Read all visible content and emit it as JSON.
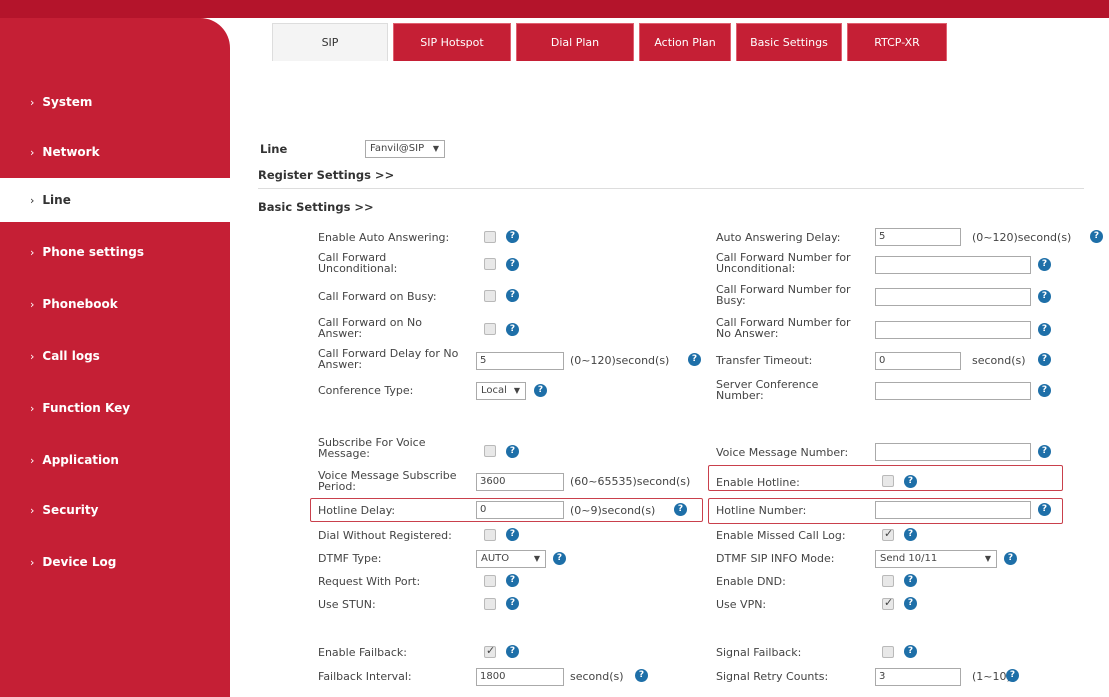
{
  "tabs": [
    "SIP",
    "SIP Hotspot",
    "Dial Plan",
    "Action Plan",
    "Basic Settings",
    "RTCP-XR"
  ],
  "sidebar": {
    "items": [
      {
        "label": "System"
      },
      {
        "label": "Network"
      },
      {
        "label": "Line"
      },
      {
        "label": "Phone settings"
      },
      {
        "label": "Phonebook"
      },
      {
        "label": "Call logs"
      },
      {
        "label": "Function Key"
      },
      {
        "label": "Application"
      },
      {
        "label": "Security"
      },
      {
        "label": "Device Log"
      }
    ],
    "active": "Line"
  },
  "line": {
    "label": "Line",
    "value": "Fanvil@SIP"
  },
  "sections": {
    "register": "Register Settings >>",
    "basic": "Basic Settings >>"
  },
  "left": {
    "auto_answer": "Enable Auto Answering:",
    "cfu": "Call Forward Unconditional:",
    "cfb": "Call Forward on Busy:",
    "cfna": "Call Forward on No Answer:",
    "cf_delay": "Call Forward Delay for No Answer:",
    "cf_delay_value": "5",
    "cf_delay_unit": "(0~120)second(s)",
    "conf_type": "Conference Type:",
    "conf_type_value": "Local",
    "subscribe_vm": "Subscribe For Voice Message:",
    "vm_period": "Voice Message Subscribe Period:",
    "vm_period_value": "3600",
    "vm_period_unit": "(60~65535)second(s)",
    "hotline_delay": "Hotline Delay:",
    "hotline_delay_value": "0",
    "hotline_delay_unit": "(0~9)second(s)",
    "dial_wo_reg": "Dial Without Registered:",
    "dtmf_type": "DTMF Type:",
    "dtmf_type_value": "AUTO",
    "req_port": "Request With Port:",
    "use_stun": "Use STUN:",
    "failback": "Enable Failback:",
    "failback_interval": "Failback Interval:",
    "failback_interval_value": "1800",
    "failback_interval_unit": "second(s)"
  },
  "right": {
    "aa_delay": "Auto Answering Delay:",
    "aa_delay_value": "5",
    "aa_delay_unit": "(0~120)second(s)",
    "cfu_num": "Call Forward Number for Unconditional:",
    "cfb_num": "Call Forward Number for Busy:",
    "cfna_num": "Call Forward Number for No Answer:",
    "transfer_timeout": "Transfer Timeout:",
    "transfer_timeout_value": "0",
    "transfer_timeout_unit": "second(s)",
    "server_conf": "Server Conference Number:",
    "vm_number": "Voice Message Number:",
    "enable_hotline": "Enable Hotline:",
    "hotline_number": "Hotline Number:",
    "missed_call": "Enable Missed Call Log:",
    "dtmf_sip_info": "DTMF SIP INFO Mode:",
    "dtmf_sip_info_value": "Send 10/11",
    "enable_dnd": "Enable DND:",
    "use_vpn": "Use VPN:",
    "signal_failback": "Signal Failback:",
    "signal_retry": "Signal Retry Counts:",
    "signal_retry_value": "3",
    "signal_retry_unit": "(1~10)"
  }
}
